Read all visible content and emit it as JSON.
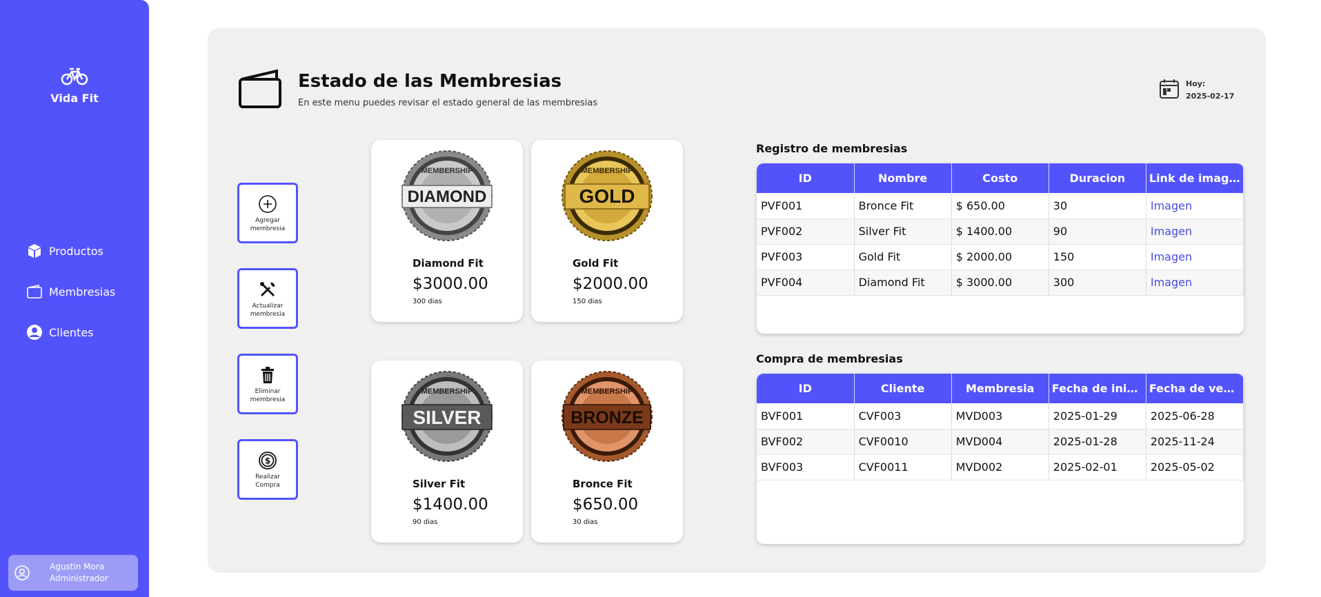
{
  "sidebar": {
    "brand": "Vida Fit",
    "nav": [
      {
        "label": "Productos",
        "icon": "box-icon"
      },
      {
        "label": "Membresias",
        "icon": "wallet-icon"
      },
      {
        "label": "Clientes",
        "icon": "user-circle-icon"
      }
    ],
    "user": {
      "name": "Agustin Mora",
      "role": "Administrador"
    }
  },
  "header": {
    "title": "Estado de las Membresias",
    "subtitle": "En este menu puedes revisar el estado general de las membresias",
    "today_label": "Hoy:",
    "today_date": "2025-02-17"
  },
  "actions": [
    {
      "line1": "Agregar",
      "line2": "membresia",
      "icon": "plus-circle-icon"
    },
    {
      "line1": "Actualizar",
      "line2": "membresia",
      "icon": "tools-icon"
    },
    {
      "line1": "Eliminar",
      "line2": "membresia",
      "icon": "trash-icon"
    },
    {
      "line1": "Realizar",
      "line2": "Compra",
      "icon": "dollar-circle-icon"
    }
  ],
  "cards": [
    {
      "badge": "DIAMOND",
      "arc": "MEMBERSHIP",
      "name": "Diamond Fit",
      "price": "$3000.00",
      "days": "300 dias"
    },
    {
      "badge": "GOLD",
      "arc": "MEMBERSHIP",
      "name": "Gold Fit",
      "price": "$2000.00",
      "days": "150 dias"
    },
    {
      "badge": "SILVER",
      "arc": "MEMBERSHIP",
      "name": "Silver Fit",
      "price": "$1400.00",
      "days": "90 dias"
    },
    {
      "badge": "BRONZE",
      "arc": "MEMBERSHIP",
      "name": "Bronce Fit",
      "price": "$650.00",
      "days": "30 dias"
    }
  ],
  "registro": {
    "title": "Registro de membresias",
    "headers": [
      "ID",
      "Nombre",
      "Costo",
      "Duracion",
      "Link de imagen"
    ],
    "rows": [
      [
        "PVF001",
        "Bronce Fit",
        "$ 650.00",
        "30",
        "Imagen"
      ],
      [
        "PVF002",
        "Silver Fit",
        "$ 1400.00",
        "90",
        "Imagen"
      ],
      [
        "PVF003",
        "Gold Fit",
        "$ 2000.00",
        "150",
        "Imagen"
      ],
      [
        "PVF004",
        "Diamond Fit",
        "$ 3000.00",
        "300",
        "Imagen"
      ]
    ]
  },
  "compra": {
    "title": "Compra de membresias",
    "headers": [
      "ID",
      "Cliente",
      "Membresia",
      "Fecha de inicio",
      "Fecha de ven..."
    ],
    "rows": [
      [
        "BVF001",
        "CVF003",
        "MVD003",
        "2025-01-29",
        "2025-06-28"
      ],
      [
        "BVF002",
        "CVF0010",
        "MVD004",
        "2025-01-28",
        "2025-11-24"
      ],
      [
        "BVF003",
        "CVF0011",
        "MVD002",
        "2025-02-01",
        "2025-05-02"
      ]
    ]
  },
  "colors": {
    "accent": "#5353fc",
    "panel": "#f0f0f0",
    "link": "#4a4ae0"
  }
}
